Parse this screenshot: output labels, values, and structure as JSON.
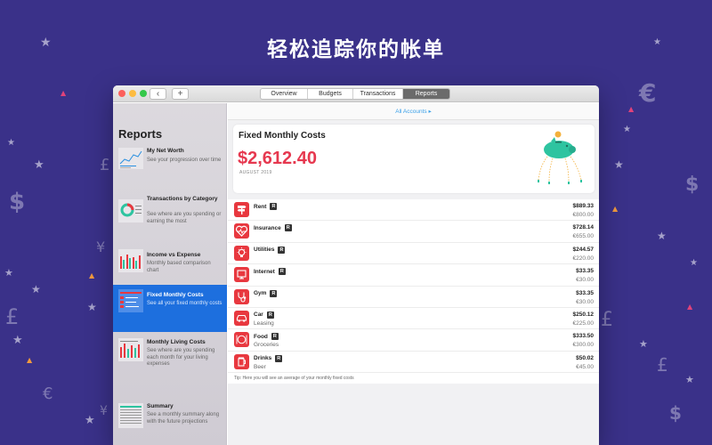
{
  "headline": "轻松追踪你的帐单",
  "window": {
    "back_label": "‹",
    "add_label": "+",
    "tabs": [
      {
        "label": "Overview",
        "active": false
      },
      {
        "label": "Budgets",
        "active": false
      },
      {
        "label": "Transactions",
        "active": false
      },
      {
        "label": "Reports",
        "active": true
      }
    ]
  },
  "sidebar": {
    "title": "Reports",
    "items": [
      {
        "title": "My Net Worth",
        "desc": "See your progression over time",
        "active": false
      },
      {
        "title": "Transactions by Category",
        "desc": "See where are you spending or earning the most",
        "active": false
      },
      {
        "title": "Income vs Expense",
        "desc": "Monthly based comparison chart",
        "active": false
      },
      {
        "title": "Fixed Monthly Costs",
        "desc": "See all your fixed monthly costs",
        "active": true
      },
      {
        "title": "Monthly Living Costs",
        "desc": "See where are you spending each month for your living expenses",
        "active": false
      },
      {
        "title": "Summary",
        "desc": "See a monthly summary along with the future projections",
        "active": false
      }
    ]
  },
  "main": {
    "accounts_label": "All Accounts ▸",
    "card": {
      "title": "Fixed Monthly Costs",
      "amount": "$2,612.40",
      "date": "AUGUST 2019"
    },
    "badge": "R",
    "rows": [
      {
        "name": "Rent",
        "sub": "",
        "amount": "$889.33",
        "amount_alt": "€800.00",
        "icon": "signpost-icon"
      },
      {
        "name": "Insurance",
        "sub": "",
        "amount": "$728.14",
        "amount_alt": "€655.00",
        "icon": "heart-pulse-icon"
      },
      {
        "name": "Utilities",
        "sub": "",
        "amount": "$244.57",
        "amount_alt": "€220.00",
        "icon": "lightbulb-icon"
      },
      {
        "name": "Internet",
        "sub": "",
        "amount": "$33.35",
        "amount_alt": "€30.00",
        "icon": "monitor-icon"
      },
      {
        "name": "Gym",
        "sub": "",
        "amount": "$33.35",
        "amount_alt": "€30.00",
        "icon": "stethoscope-icon"
      },
      {
        "name": "Car",
        "sub": "Leasing",
        "amount": "$250.12",
        "amount_alt": "€225.00",
        "icon": "car-icon"
      },
      {
        "name": "Food",
        "sub": "Groceries",
        "amount": "$333.50",
        "amount_alt": "€300.00",
        "icon": "fork-knife-icon"
      },
      {
        "name": "Drinks",
        "sub": "Beer",
        "amount": "$50.02",
        "amount_alt": "€45.00",
        "icon": "beer-glass-icon"
      }
    ],
    "tip": "Tip: Here you will see an average of your monthly fixed costs"
  },
  "colors": {
    "background": "#3a3189",
    "accent_red": "#e6384f",
    "selection_blue": "#1d6fde",
    "link_blue": "#3aa0e8",
    "piggy_green": "#2ec4a0"
  }
}
